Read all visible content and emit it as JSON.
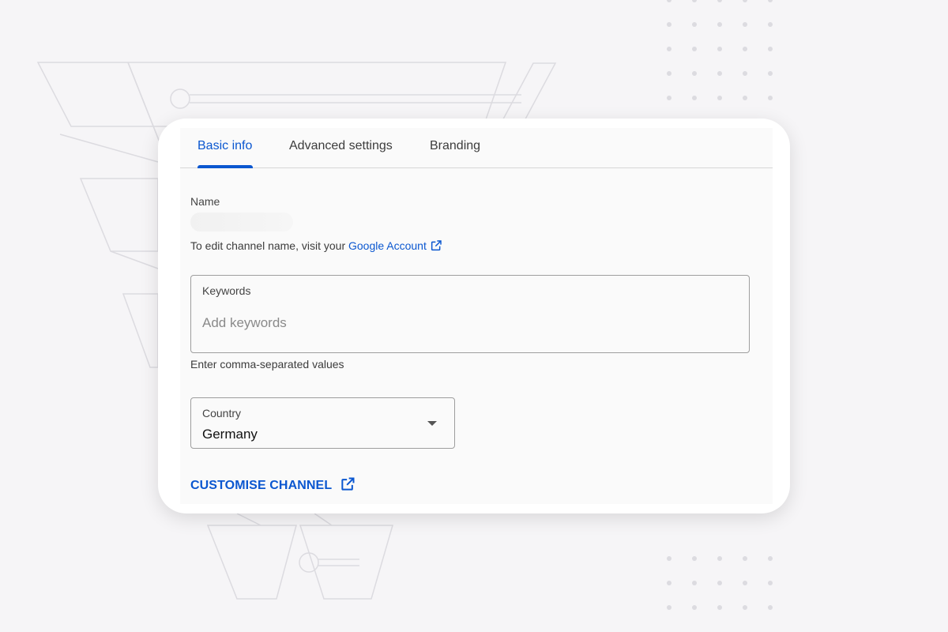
{
  "tabs": [
    {
      "label": "Basic info",
      "active": true
    },
    {
      "label": "Advanced settings",
      "active": false
    },
    {
      "label": "Branding",
      "active": false
    }
  ],
  "name": {
    "label": "Name",
    "value": ""
  },
  "edit_hint": {
    "text": "To edit channel name, visit your ",
    "link_label": "Google Account",
    "link_icon": "open-in-new-icon"
  },
  "keywords": {
    "label": "Keywords",
    "placeholder": "Add keywords",
    "value": "",
    "helper": "Enter comma-separated values"
  },
  "country": {
    "label": "Country",
    "selected": "Germany",
    "icon": "dropdown-arrow-icon"
  },
  "customise": {
    "label": "CUSTOMISE CHANNEL",
    "icon": "open-in-new-icon"
  },
  "colors": {
    "accent": "#0b57d0",
    "background": "#f6f5f7",
    "card": "#ffffff",
    "border": "#9e9e9e"
  }
}
